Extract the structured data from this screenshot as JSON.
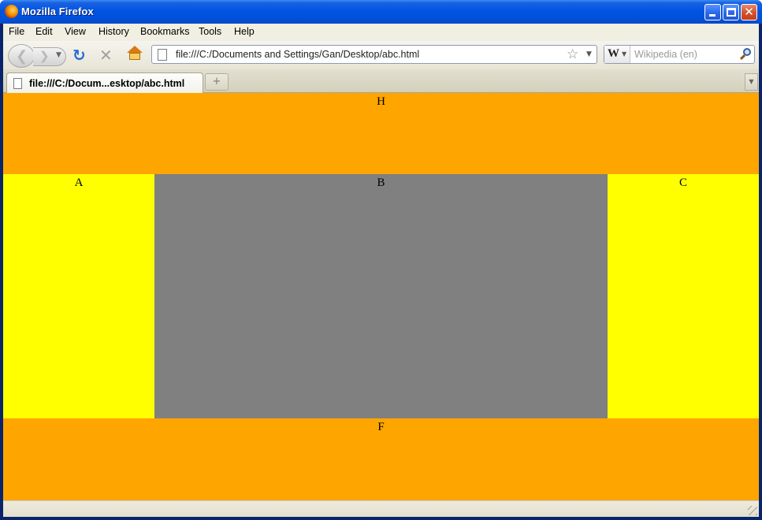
{
  "window": {
    "title": "Mozilla Firefox"
  },
  "menubar": {
    "items": [
      "File",
      "Edit",
      "View",
      "History",
      "Bookmarks",
      "Tools",
      "Help"
    ]
  },
  "navbar": {
    "url": "file:///C:/Documents and Settings/Gan/Desktop/abc.html",
    "search_placeholder": "Wikipedia (en)",
    "search_engine_glyph": "W"
  },
  "tabs": [
    {
      "label": "file:///C:/Docum...esktop/abc.html",
      "active": true
    }
  ],
  "page": {
    "header": {
      "label": "H",
      "color": "#ffa500"
    },
    "left": {
      "label": "A",
      "color": "#ffff00"
    },
    "center": {
      "label": "B",
      "color": "#808080"
    },
    "right": {
      "label": "C",
      "color": "#ffff00"
    },
    "footer": {
      "label": "F",
      "color": "#ffa500"
    }
  }
}
